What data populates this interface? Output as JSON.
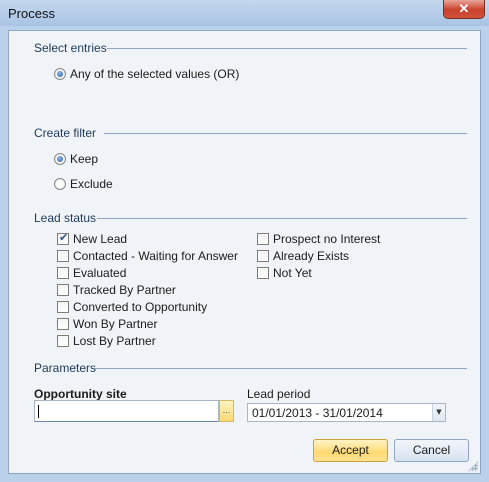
{
  "window": {
    "title": "Process",
    "close_glyph": "✕"
  },
  "select_entries": {
    "heading": "Select entries",
    "options": [
      {
        "label": "Any of the selected values (OR)",
        "selected": true
      }
    ]
  },
  "create_filter": {
    "heading": "Create filter",
    "options": [
      {
        "label": "Keep",
        "selected": true
      },
      {
        "label": "Exclude",
        "selected": false
      }
    ]
  },
  "lead_status": {
    "heading": "Lead status",
    "items": [
      {
        "label": "New Lead",
        "checked": true
      },
      {
        "label": "Contacted - Waiting for Answer",
        "checked": false
      },
      {
        "label": "Evaluated",
        "checked": false
      },
      {
        "label": "Tracked By Partner",
        "checked": false
      },
      {
        "label": "Converted to Opportunity",
        "checked": false
      },
      {
        "label": "Won By Partner",
        "checked": false
      },
      {
        "label": "Lost By Partner",
        "checked": false
      },
      {
        "label": "Prospect no Interest",
        "checked": false
      },
      {
        "label": "Already Exists",
        "checked": false
      },
      {
        "label": "Not Yet",
        "checked": false
      }
    ]
  },
  "parameters": {
    "heading": "Parameters",
    "opportunity_site": {
      "label": "Opportunity site",
      "value": "",
      "browse_glyph": "..."
    },
    "lead_period": {
      "label": "Lead period",
      "value": "01/01/2013 - 31/01/2014",
      "arrow_glyph": "▼"
    }
  },
  "buttons": {
    "accept": "Accept",
    "cancel": "Cancel"
  },
  "colors": {
    "accent_yellow": "#ffd873",
    "frame_blue": "#b9d1ea",
    "heading_blue": "#1e395b"
  }
}
